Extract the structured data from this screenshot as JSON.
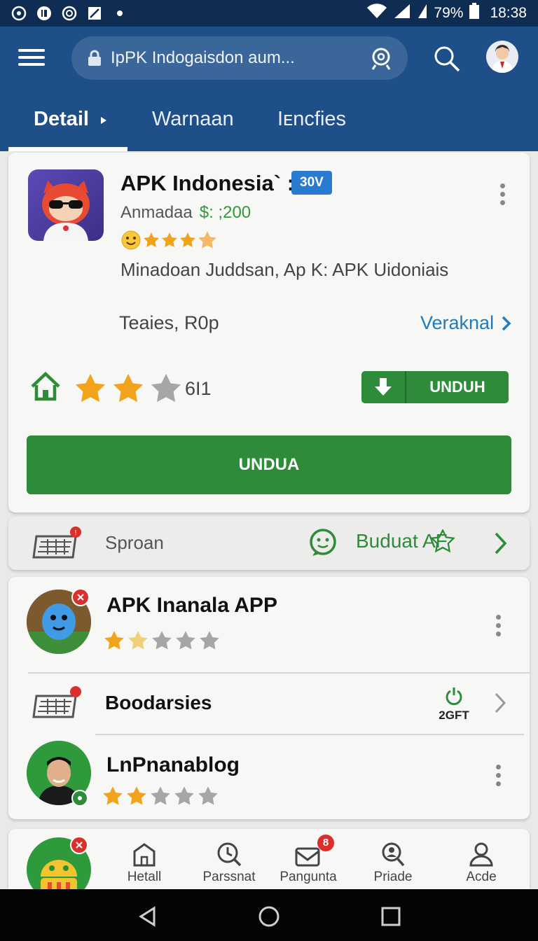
{
  "status_bar": {
    "battery": "79%",
    "time": "18:38",
    "icons": [
      "wifi-icon",
      "signal-icon",
      "battery-icon"
    ]
  },
  "header": {
    "search_text": "IpPK Indogaisdon aum...",
    "tabs": [
      {
        "label": "Detail",
        "active": true
      },
      {
        "label": "Warnaan",
        "active": false
      },
      {
        "label": "Iᴇncfies",
        "active": false
      }
    ]
  },
  "app_card": {
    "title": "APK Indonesia` :",
    "badge": "30V",
    "subtitle": "Anmadaa",
    "price": "$: ;200",
    "description": "Minadoan Juddsan, Ap K: APK Uidoniais",
    "meta": "Teaies, R0p",
    "more_link": "Veraknal",
    "rating_count": "6I1",
    "download_label": "UNDUH",
    "primary_button": "UNDUA",
    "stars_top": 3.5,
    "stars_main": 2
  },
  "promo_row": {
    "label": "Sproan",
    "action": "Buduat AF"
  },
  "list": [
    {
      "title": "APK Inanala APP",
      "stars": 1.5
    },
    {
      "title": "Boodarsies",
      "timer": "2GFT"
    },
    {
      "title": "LnPnanablog",
      "stars": 2
    }
  ],
  "bottom_nav": [
    {
      "label": "Hetall"
    },
    {
      "label": "Parssnat"
    },
    {
      "label": "Pangunta",
      "badge": "8"
    },
    {
      "label": "Priade"
    },
    {
      "label": "Acde"
    }
  ],
  "colors": {
    "header": "#1f4f89",
    "status": "#0f2c52",
    "green": "#2e8b3a",
    "link": "#1f7bc0",
    "star": "#f2a31b"
  }
}
